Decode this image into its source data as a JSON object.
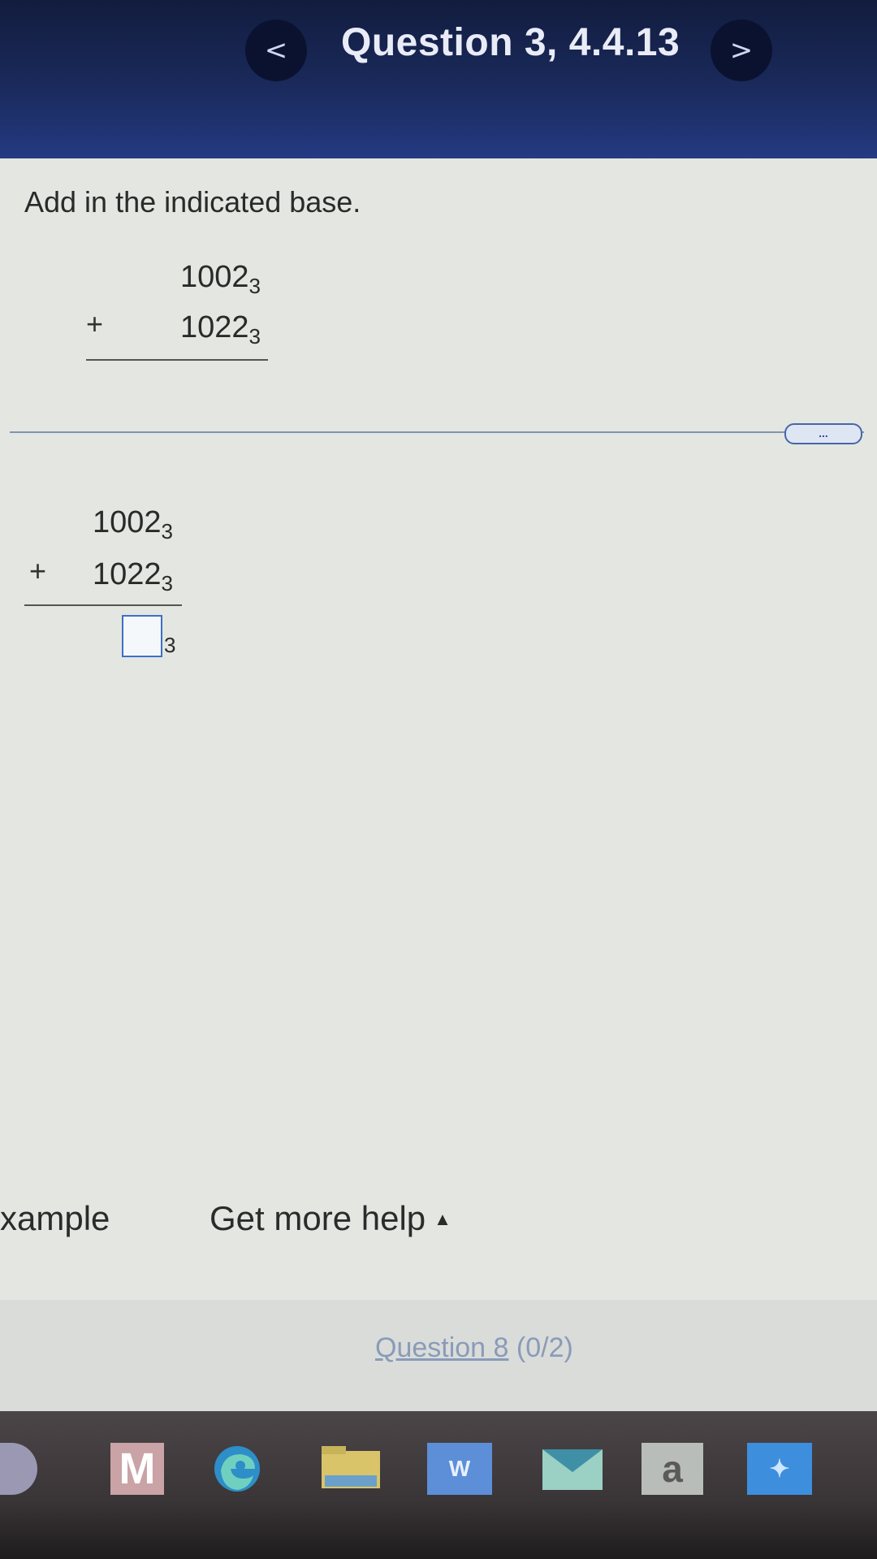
{
  "header": {
    "prev_label": "<",
    "title": "Question 3, 4.4.13",
    "next_label": ">"
  },
  "problem": {
    "instruction": "Add in the indicated base.",
    "addend1": "1002",
    "addend2": "1022",
    "base": "3",
    "operator": "+"
  },
  "work": {
    "addend1": "1002",
    "addend2": "1022",
    "base": "3",
    "operator": "+",
    "answer_value": "",
    "answer_base": "3"
  },
  "more_button": "...",
  "footer": {
    "example_label": "xample",
    "help_label": "Get more help",
    "help_caret": "▲"
  },
  "progress": {
    "question_link": "Question 8",
    "score": "(0/2)"
  },
  "taskbar": {
    "mail_letter": "M",
    "word_letter": "W",
    "amazon_letter": "a",
    "dropbox_glyph": "✦"
  },
  "colors": {
    "header_bg": "#1a2a5c",
    "answer_box_border": "#3e6fc8",
    "divider": "#7f94b2"
  }
}
